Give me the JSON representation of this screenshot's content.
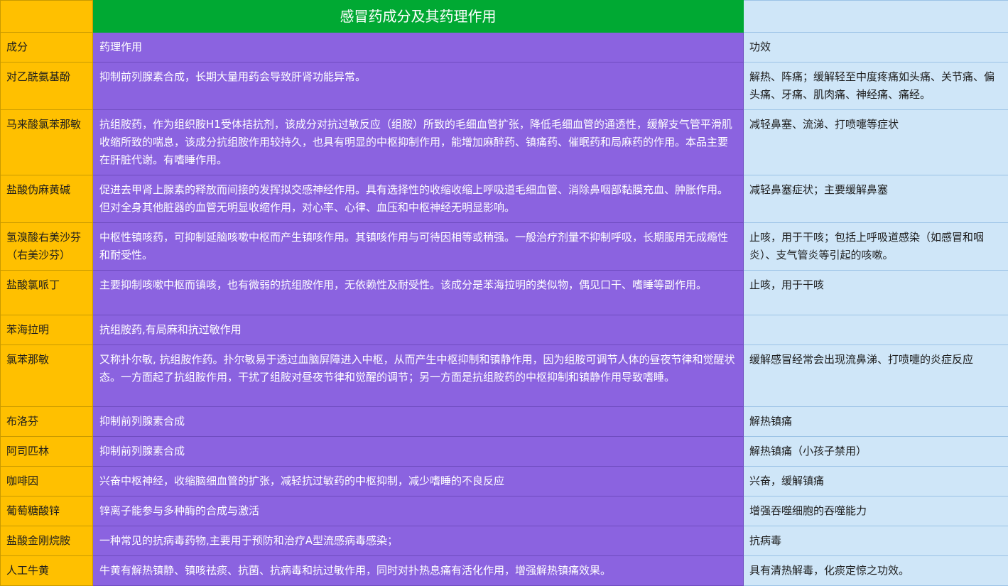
{
  "title": "感冒药成分及其药理作用",
  "headers": {
    "name": "成分",
    "mechanism": "药理作用",
    "effect": "功效"
  },
  "rows": [
    {
      "name": "对乙酰氨基酚",
      "mechanism": "抑制前列腺素合成，长期大量用药会导致肝肾功能异常。",
      "effect": "解热、阵痛；缓解轻至中度疼痛如头痛、关节痛、偏头痛、牙痛、肌肉痛、神经痛、痛经。"
    },
    {
      "name": "马来酸氯苯那敏",
      "mechanism": "抗组胺药，作为组织胺H1受体拮抗剂，该成分对抗过敏反应（组胺）所致的毛细血管扩张，降低毛细血管的通透性，缓解支气管平滑肌收缩所致的喘息，该成分抗组胺作用较持久，也具有明显的中枢抑制作用，能增加麻醉药、镇痛药、催眠药和局麻药的作用。本品主要在肝脏代谢。有嗜睡作用。",
      "effect": "减轻鼻塞、流涕、打喷嚏等症状"
    },
    {
      "name": "盐酸伪麻黄碱",
      "mechanism": "促进去甲肾上腺素的释放而间接的发挥拟交感神经作用。具有选择性的收缩收缩上呼吸道毛细血管、消除鼻咽部黏膜充血、肿胀作用。但对全身其他脏器的血管无明显收缩作用，对心率、心律、血压和中枢神经无明显影响。",
      "effect": "减轻鼻塞症状；主要缓解鼻塞"
    },
    {
      "name": "氢溴酸右美沙芬（右美沙芬）",
      "mechanism": "中枢性镇咳药，可抑制延脑咳嗽中枢而产生镇咳作用。其镇咳作用与可待因相等或稍强。一般治疗剂量不抑制呼吸，长期服用无成瘾性和耐受性。",
      "effect": "止咳，用于干咳；包括上呼吸道感染（如感冒和咽炎）、支气管炎等引起的咳嗽。"
    },
    {
      "name": "盐酸氯哌丁",
      "mechanism": "主要抑制咳嗽中枢而镇咳，也有微弱的抗组胺作用，无依赖性及耐受性。该成分是苯海拉明的类似物，偶见口干、嗜睡等副作用。",
      "effect": "止咳，用于干咳"
    },
    {
      "name": "苯海拉明",
      "mechanism": "抗组胺药,有局麻和抗过敏作用",
      "effect": ""
    },
    {
      "name": "氯苯那敏",
      "mechanism": "又称扑尔敏, 抗组胺作药。扑尔敏易于透过血脑屏障进入中枢，从而产生中枢抑制和镇静作用，因为组胺可调节人体的昼夜节律和觉醒状态。一方面起了抗组胺作用，干扰了组胺对昼夜节律和觉醒的调节；另一方面是抗组胺药的中枢抑制和镇静作用导致嗜睡。",
      "effect": "缓解感冒经常会出现流鼻涕、打喷嚏的炎症反应"
    },
    {
      "name": "布洛芬",
      "mechanism": "抑制前列腺素合成",
      "effect": "解热镇痛"
    },
    {
      "name": "阿司匹林",
      "mechanism": "抑制前列腺素合成",
      "effect": "解热镇痛（小孩子禁用）"
    },
    {
      "name": "咖啡因",
      "mechanism": "兴奋中枢神经，收缩脑细血管的扩张，减轻抗过敏药的中枢抑制，减少嗜睡的不良反应",
      "effect": "兴奋，缓解镇痛"
    },
    {
      "name": "葡萄糖酸锌",
      "mechanism": "锌离子能参与多种酶的合成与激活",
      "effect": "增强吞噬细胞的吞噬能力"
    },
    {
      "name": "盐酸金刚烷胺",
      "mechanism": "一种常见的抗病毒药物,主要用于预防和治疗A型流感病毒感染；",
      "effect": "抗病毒"
    },
    {
      "name": "人工牛黄",
      "mechanism": "牛黄有解热镇静、镇咳祛痰、抗菌、抗病毒和抗过敏作用，同时对扑热息痛有活化作用，增强解热镇痛效果。",
      "effect": "具有清热解毒，化痰定惊之功效。"
    }
  ]
}
